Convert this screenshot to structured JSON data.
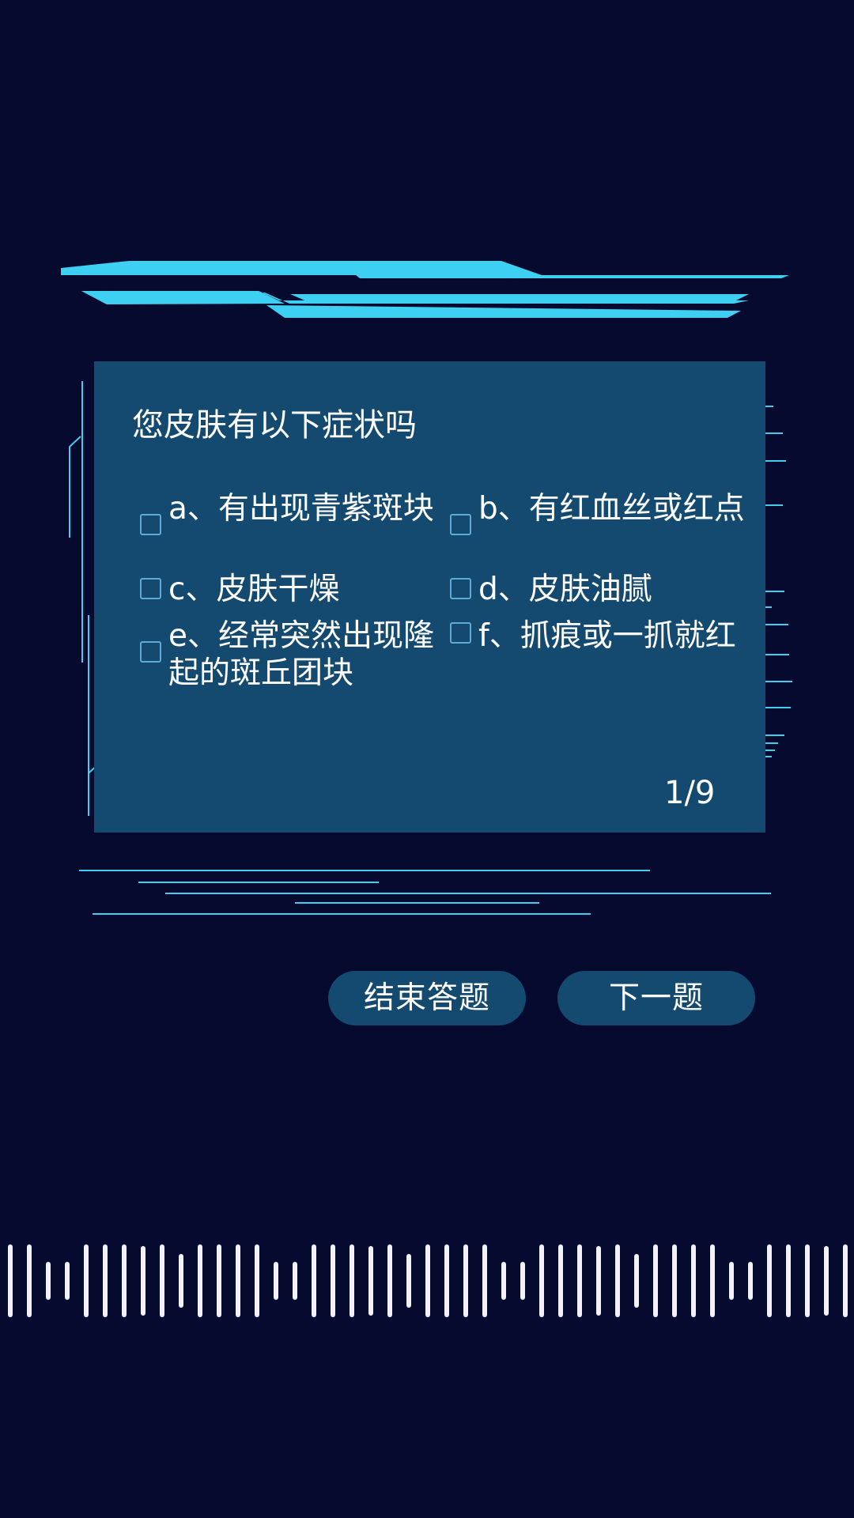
{
  "question": {
    "title": "您皮肤有以下症状吗",
    "options": [
      {
        "label": "a、有出现青紫斑块",
        "checked": false
      },
      {
        "label": "b、有红血丝或红点",
        "checked": false
      },
      {
        "label": "c、皮肤干燥",
        "checked": false
      },
      {
        "label": "d、皮肤油腻",
        "checked": false
      },
      {
        "label": "e、经常突然出现隆起的斑丘团块",
        "checked": false
      },
      {
        "label": "f、抓痕或一抓就红",
        "checked": false
      }
    ],
    "counter": "1/9"
  },
  "buttons": {
    "end_label": "结束答题",
    "next_label": "下一题"
  },
  "colors": {
    "background": "#050a2e",
    "panel": "#154a70",
    "accent": "#3ed0f3",
    "checkbox_border": "#5da9d8",
    "text": "#ffffff"
  }
}
